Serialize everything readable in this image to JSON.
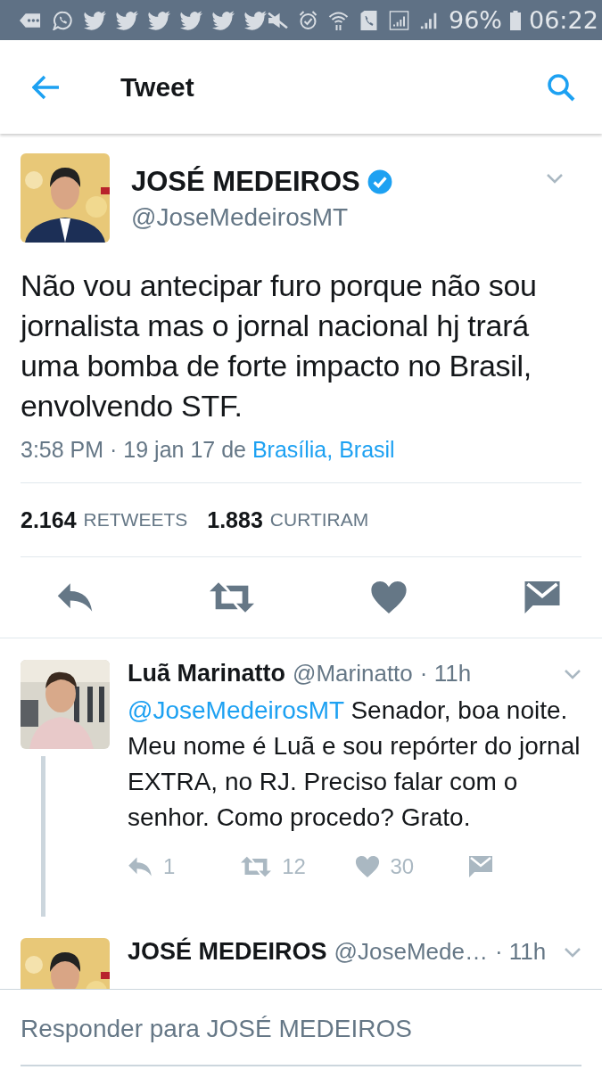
{
  "status_bar": {
    "battery": "96%",
    "time": "06:22"
  },
  "header": {
    "title": "Tweet"
  },
  "tweet": {
    "name": "JOSÉ MEDEIROS",
    "verified": true,
    "handle": "@JoseMedeirosMT",
    "text": "Não vou antecipar furo porque não sou jornalista mas o jornal nacional hj trará uma bomba de forte impacto no Brasil, envolvendo STF.",
    "timestamp": "3:58 PM · 19 jan 17",
    "location_prefix": "de",
    "location": "Brasília, Brasil",
    "stats": [
      {
        "count": "2.164",
        "label": "RETWEETS"
      },
      {
        "count": "1.883",
        "label": "CURTIRAM"
      }
    ]
  },
  "replies": [
    {
      "name": "Luã Marinatto",
      "handle": "@Marinatto",
      "time": "· 11h",
      "mention": "@JoseMedeirosMT",
      "text": "Senador, boa noite. Meu nome é Luã e sou repórter do jornal EXTRA, no RJ. Preciso falar com o senhor. Como procedo? Grato.",
      "thread_line": true,
      "counts": {
        "reply": "1",
        "retweet": "12",
        "like": "30"
      }
    },
    {
      "name": "JOSÉ MEDEIROS",
      "handle": "@JoseMede…",
      "time": "· 11h",
      "thread_line": false
    }
  ],
  "reply_bar": {
    "placeholder": "Responder para JOSÉ MEDEIROS"
  }
}
